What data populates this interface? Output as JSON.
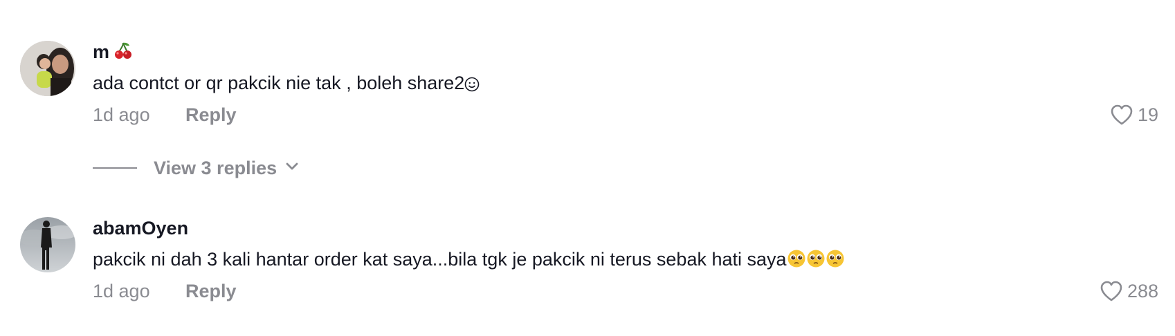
{
  "comments": [
    {
      "username": "m",
      "username_emoji": "cherry-icon",
      "text": "ada contct or qr pakcik nie tak , boleh share2",
      "text_emoji": "smiling-face-icon",
      "time": "1d ago",
      "reply_label": "Reply",
      "likes": "19",
      "view_replies_label": "View 3 replies"
    },
    {
      "username": "abamOyen",
      "text": "pakcik ni dah 3 kali hantar order kat saya...bila tgk je pakcik ni terus sebak hati saya",
      "text_emoji": "pleading-face-icon",
      "text_emoji_count": 3,
      "time": "1d ago",
      "reply_label": "Reply",
      "likes": "288"
    }
  ],
  "colors": {
    "text": "#161823",
    "secondary": "#8a8b91",
    "background": "#ffffff"
  }
}
